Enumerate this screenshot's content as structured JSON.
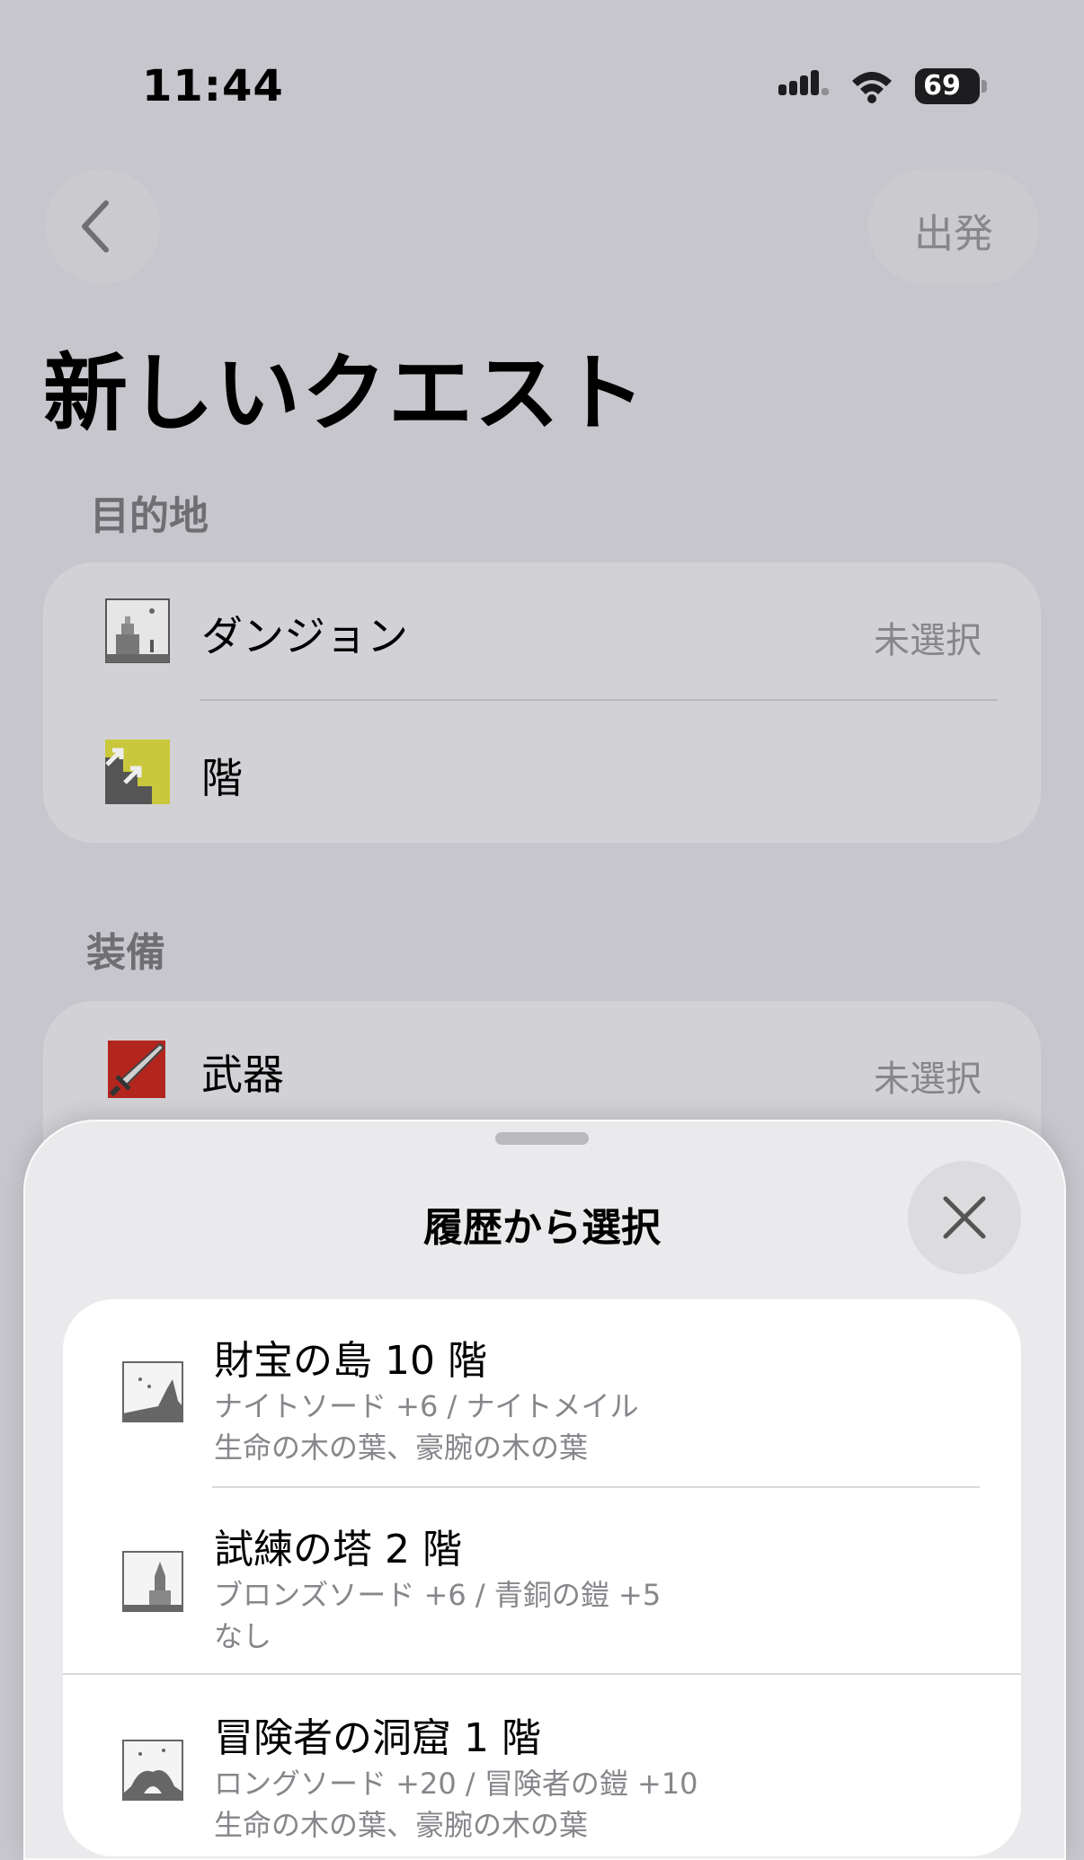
{
  "status_bar": {
    "time": "11:44",
    "battery": "69"
  },
  "nav": {
    "depart_label": "出発"
  },
  "page_title": "新しいクエスト",
  "destination": {
    "section_label": "目的地",
    "rows": [
      {
        "label": "ダンジョン",
        "value": "未選択",
        "icon": "dungeon-castle-icon"
      },
      {
        "label": "階",
        "value": "",
        "icon": "stairs-icon"
      }
    ]
  },
  "equipment": {
    "section_label": "装備",
    "rows": [
      {
        "label": "武器",
        "value": "未選択",
        "icon": "sword-icon"
      }
    ]
  },
  "sheet": {
    "title": "履歴から選択",
    "items": [
      {
        "title": "財宝の島 10 階",
        "line1": "ナイトソード +6 / ナイトメイル",
        "line2": "生命の木の葉、豪腕の木の葉",
        "icon": "island-icon"
      },
      {
        "title": "試練の塔 2 階",
        "line1": "ブロンズソード +6 / 青銅の鎧 +5",
        "line2": "なし",
        "icon": "tower-icon"
      },
      {
        "title": "冒険者の洞窟 1 階",
        "line1": "ロングソード +20 / 冒険者の鎧 +10",
        "line2": "生命の木の葉、豪腕の木の葉",
        "icon": "cave-icon"
      }
    ]
  },
  "colors": {
    "accent_yellow": "#c9c73c",
    "weapon_red": "#b3261e",
    "secondary_text": "#86868b"
  }
}
